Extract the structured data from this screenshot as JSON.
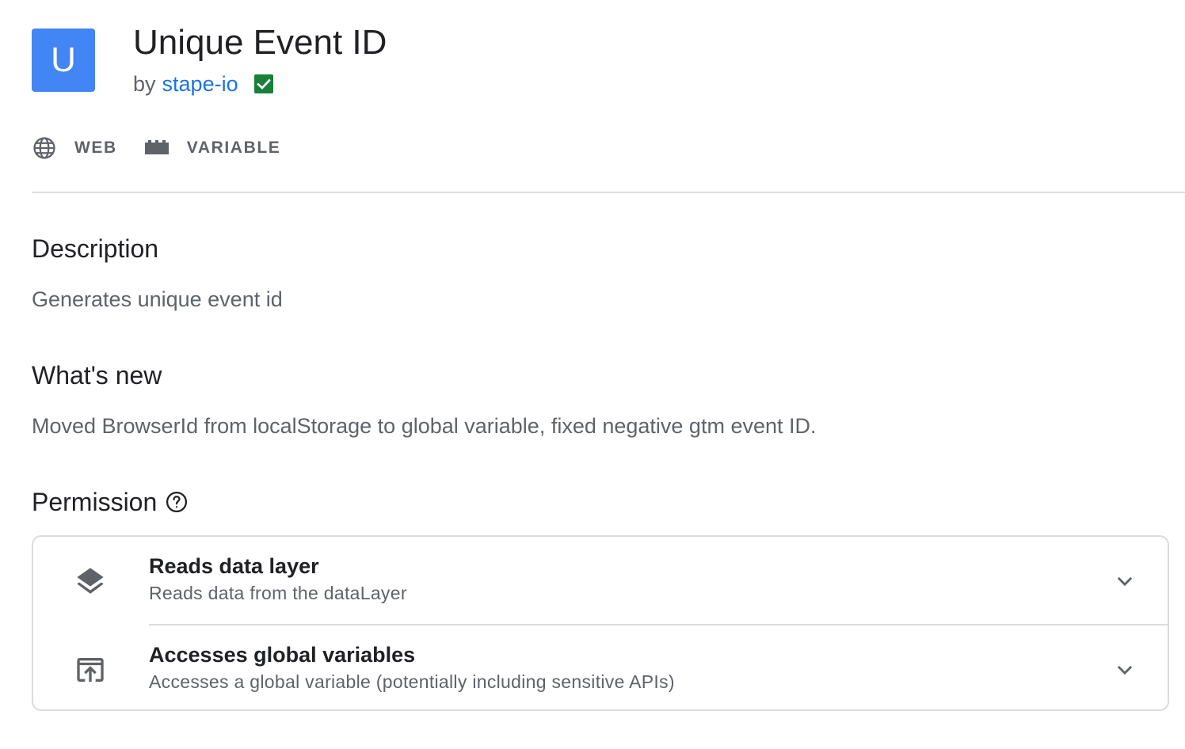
{
  "header": {
    "logo_letter": "U",
    "title": "Unique Event ID",
    "by_prefix": "by",
    "author": "stape-io",
    "verified_icon": "verified-check-icon",
    "colors": {
      "logo_bg": "#4285f4",
      "author_link": "#1a73e8",
      "verified": "#188038"
    }
  },
  "tags": [
    {
      "icon": "globe-icon",
      "label": "WEB"
    },
    {
      "icon": "variable-block-icon",
      "label": "VARIABLE"
    }
  ],
  "description": {
    "heading": "Description",
    "text": "Generates unique event id"
  },
  "whats_new": {
    "heading": "What's new",
    "text": "Moved BrowserId from localStorage to global variable, fixed negative gtm event ID."
  },
  "permission": {
    "heading": "Permission",
    "help_icon": "help-circle-icon",
    "items": [
      {
        "icon": "layers-icon",
        "title": "Reads data layer",
        "description": "Reads data from the dataLayer",
        "expand_icon": "chevron-down-icon"
      },
      {
        "icon": "open-in-browser-icon",
        "title": "Accesses global variables",
        "description": "Accesses a global variable (potentially including sensitive APIs)",
        "expand_icon": "chevron-down-icon"
      }
    ]
  }
}
